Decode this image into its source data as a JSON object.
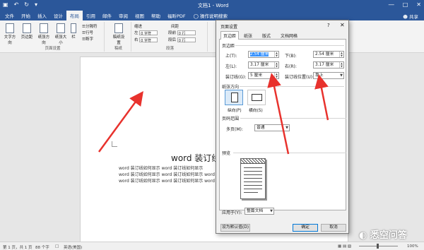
{
  "titlebar": {
    "qat": [
      "save-icon",
      "undo-icon",
      "redo-icon",
      "customize-icon"
    ],
    "qat_glyphs": [
      "▣",
      "↶",
      "↻",
      "▾"
    ],
    "title": "文档1 - Word",
    "controls": [
      "―",
      "□",
      "✕"
    ]
  },
  "tabs": [
    "文件",
    "开始",
    "插入",
    "设计",
    "布局",
    "引用",
    "邮件",
    "审阅",
    "视图",
    "帮助",
    "福昕PDF"
  ],
  "active_tab_index": 4,
  "tell_me": "操作说明搜索",
  "share": "共享",
  "ribbon": {
    "page_setup": {
      "buttons": [
        "文字方向",
        "页边距",
        "纸张方向",
        "纸张大小",
        "栏"
      ],
      "small": [
        "分隔符",
        "行号",
        "断字"
      ],
      "label": "页面设置"
    },
    "draft": {
      "button": "稿纸设置",
      "label": "稿纸"
    },
    "paragraph": {
      "indent_title": "缩进",
      "spacing_title": "间距",
      "indent_left": "左",
      "indent_right": "右",
      "indent_left_val": "0 字符",
      "indent_right_val": "0 字符",
      "before_label": "段前",
      "after_label": "段后",
      "before_val": "0 行",
      "after_val": "0 行",
      "label": "段落"
    }
  },
  "document": {
    "heading": "word 装订线",
    "lines": [
      "word 装订线如何显示 word 装订线如何显示",
      "word 装订线如何显示 word 装订线如何显示 word",
      "word 装订线如何显示 word 装订线如何显示 word"
    ]
  },
  "dialog": {
    "title": "页面设置",
    "help": "?",
    "close": "✕",
    "tabs": [
      "页边距",
      "纸张",
      "版式",
      "文档网格"
    ],
    "margins_title": "页边距",
    "top_label": "上(T):",
    "top_val": "2.54 厘米",
    "bottom_label": "下(B):",
    "bottom_val": "2.54 厘米",
    "left_label": "左(L):",
    "left_val": "3.17 厘米",
    "right_label": "右(R):",
    "right_val": "3.17 厘米",
    "gutter_label": "装订线(G):",
    "gutter_val": "5 厘米",
    "gutter_pos_label": "装订线位置(U):",
    "gutter_pos_val": "靠上",
    "orientation_title": "纸张方向",
    "portrait": "纵向(P)",
    "landscape": "横向(S)",
    "pages_title": "页码范围",
    "multiple_pages_label": "多页(M):",
    "multiple_pages_val": "普通",
    "preview_title": "预览",
    "apply_label": "应用于(Y):",
    "apply_val": "整篇文档",
    "default_btn": "设为默认值(D)",
    "ok_btn": "确定",
    "cancel_btn": "取消"
  },
  "status": {
    "page": "第 1 页，共 1 页",
    "words": "88 个字",
    "lang": "英语(美国)",
    "zoom": "100%"
  },
  "watermark": "悉空问答",
  "colors": {
    "word_blue": "#2b579a",
    "arrow_red": "#e8322d",
    "selection": "#3390ff"
  }
}
